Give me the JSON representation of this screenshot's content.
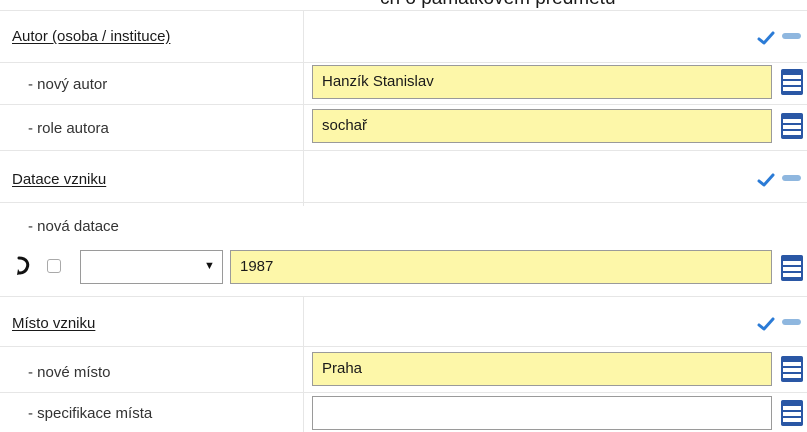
{
  "top_clipped_text": "ch o památkovém předmětu",
  "sections": {
    "author": {
      "title": "Autor (osoba / instituce)",
      "new_label": "- nový autor",
      "new_value": "Hanzík Stanislav",
      "role_label": "- role autora",
      "role_value": "sochař"
    },
    "dating": {
      "title": "Datace vzniku",
      "new_label": "- nová datace",
      "select_value": "",
      "value": "1987"
    },
    "place": {
      "title": "Místo vzniku",
      "new_label": "- nové místo",
      "new_value": "Praha",
      "spec_label": "- specifikace místa",
      "spec_value": ""
    }
  },
  "icons": {
    "check": "checkmark-icon",
    "minus": "minus-icon",
    "list": "list-menu-icon",
    "hook": "hook-arrow-icon"
  },
  "colors": {
    "field_highlight": "#fdf7a9",
    "check_blue": "#2b7bd6",
    "minus_blue": "#8fb7df",
    "list_blue": "#2a57a5"
  }
}
